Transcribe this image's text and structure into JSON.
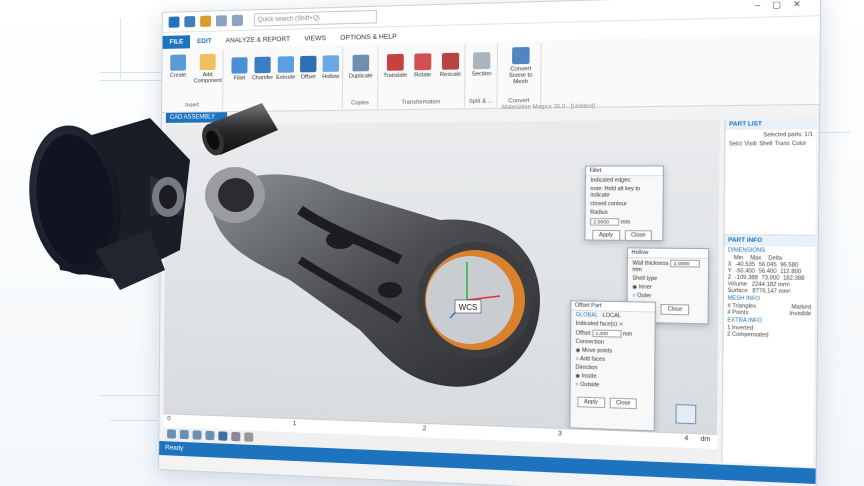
{
  "app": {
    "title": "Materialise Magics 26.0 - [Untitled]"
  },
  "quick_access": {
    "search_placeholder": "Quick search (Shift+Q)"
  },
  "tabs": [
    {
      "label": "FILE"
    },
    {
      "label": "EDIT"
    },
    {
      "label": "ANALYZE & REPORT"
    },
    {
      "label": "VIEWS"
    },
    {
      "label": "OPTIONS & HELP"
    }
  ],
  "ribbon": {
    "insert": {
      "label": "Insert",
      "buttons": [
        "Create",
        "Add Component"
      ]
    },
    "edit": {
      "buttons": [
        "Fillet",
        "Chamfer",
        "Extrude",
        "Offset",
        "Hollow"
      ]
    },
    "copies": {
      "label": "Copies",
      "buttons": [
        "Duplicate"
      ]
    },
    "transformation": {
      "label": "Transformation",
      "buttons": [
        "Translate",
        "Rotate",
        "Rescale"
      ]
    },
    "split": {
      "label": "Split & ...",
      "buttons": [
        "Section"
      ]
    },
    "convert": {
      "label": "Convert",
      "buttons": [
        "Convert Scene to Mesh"
      ]
    },
    "context_tab": "CAD ASSEMBLY"
  },
  "viewport": {
    "wcs_label": "WCS",
    "ruler": {
      "ticks": [
        "0",
        "1",
        "2",
        "3",
        "4"
      ],
      "unit": "dm"
    }
  },
  "status": {
    "text": "Ready"
  },
  "sidebar": {
    "part_list_title": "PART LIST",
    "selected_parts": "Selected parts: 1/1",
    "columns": [
      "Selct",
      "Visib",
      "Shell",
      "Trans",
      "Color"
    ],
    "part_info_title": "PART INFO",
    "dimensions_title": "DIMENSIONS",
    "dim_headers": [
      "Min",
      "Max",
      "Delta"
    ],
    "dims": [
      {
        "axis": "X",
        "min": "-40.535",
        "max": "56.045",
        "delta": "96.580"
      },
      {
        "axis": "Y",
        "min": "-56.400",
        "max": "56.400",
        "delta": "112.800"
      },
      {
        "axis": "Z",
        "min": "-109.388",
        "max": "73.000",
        "delta": "182.388"
      }
    ],
    "volume_label": "Volume",
    "volume": "2244.182 mm³",
    "surface_label": "Surface",
    "surface": "8776.147 mm²",
    "mesh_info_title": "MESH INFO",
    "triangles_label": "# Triangles",
    "points_label": "# Points",
    "marked_label": "Marked",
    "invisible_label": "Invisible",
    "extra_info_title": "EXTRA INFO",
    "extra_lines": [
      "1 Inverted",
      "2 Compensated"
    ]
  },
  "dialogs": {
    "fillet": {
      "title": "Fillet",
      "lines": [
        "Indicated edges:",
        "note: Hold alt key to indicate",
        "closed contour"
      ],
      "radius_label": "Radius",
      "radius_value": "2.0000",
      "unit": "mm",
      "apply": "Apply",
      "close": "Close"
    },
    "hollow": {
      "title": "Hollow",
      "wall_label": "Wall thickness",
      "wall_value": "2.0000",
      "unit": "mm",
      "shell_label": "Shell type",
      "options": [
        "Inner",
        "Outer"
      ],
      "ok": "OK",
      "close": "Close"
    },
    "offset": {
      "title": "Offset Part",
      "tabs": [
        "GLOBAL",
        "LOCAL"
      ],
      "indicated_label": "Indicated face(s)",
      "offset_label": "Offset",
      "offset_value": "1.000",
      "unit": "mm",
      "connection_label": "Connection",
      "connection_options": [
        "Move points",
        "Add faces"
      ],
      "direction_label": "Direction",
      "direction_options": [
        "Inside",
        "Outside"
      ],
      "apply": "Apply",
      "close": "Close"
    }
  },
  "colors": {
    "accent": "#1e73be",
    "part_dark": "#3c3c3e",
    "part_highlight": "#d9822b",
    "piston": "#1d1f2a"
  }
}
